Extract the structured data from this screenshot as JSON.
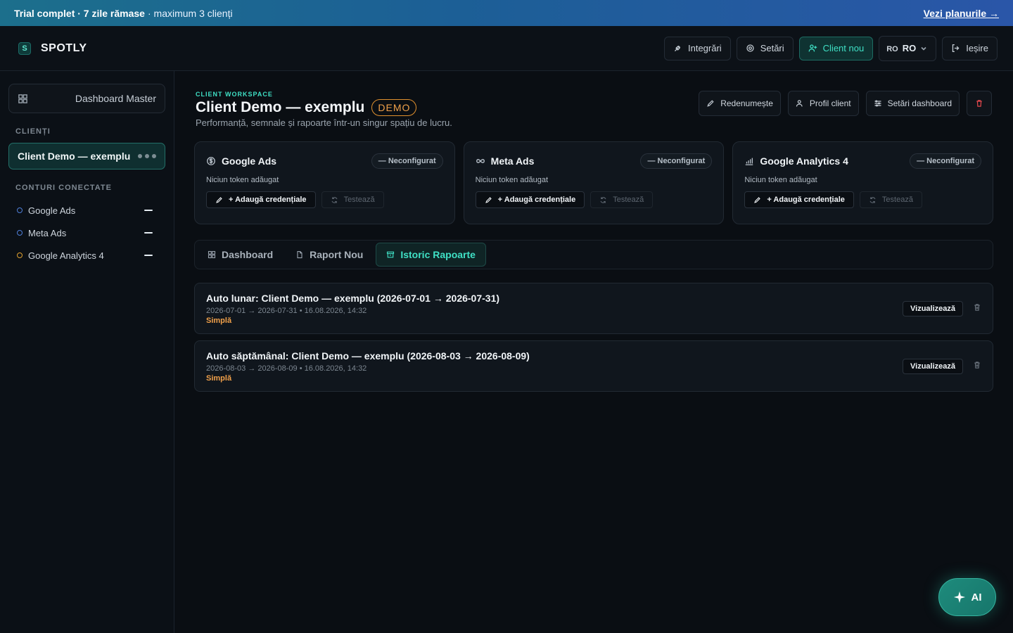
{
  "banner": {
    "strong": "Trial complet · 7 zile rămase",
    "light": "· maximum 3 clienți",
    "link": "Vezi planurile →"
  },
  "header": {
    "logo_letter": "S",
    "brand": "SPOTLY",
    "integrations": "Integrări",
    "settings": "Setări",
    "new_client": "Client nou",
    "lang_flag": "RO",
    "lang_code": "RO",
    "logout": "Ieșire"
  },
  "sidebar": {
    "master": "Dashboard Master",
    "clients_heading": "CLIENȚI",
    "client_active": "Client Demo — exemplu",
    "accounts_heading": "CONTURI CONECTATE",
    "accounts": [
      {
        "label": "Google Ads",
        "dot_color": "#4f7fd9"
      },
      {
        "label": "Meta Ads",
        "dot_color": "#4f7fd9"
      },
      {
        "label": "Google Analytics 4",
        "dot_color": "#e0a02e"
      }
    ]
  },
  "workspace": {
    "eyebrow": "CLIENT WORKSPACE",
    "title": "Client Demo — exemplu",
    "badge": "DEMO",
    "subtitle": "Performanță, semnale și rapoarte într-un singur spațiu de lucru.",
    "actions": {
      "rename": "Redenumește",
      "profile": "Profil client",
      "dashboard_settings": "Setări dashboard"
    }
  },
  "integrations": [
    {
      "name": "Google Ads",
      "icon": "dollar-circle-icon",
      "status": "— Neconfigurat",
      "token": "Niciun token adăugat",
      "add": "+ Adaugă credențiale",
      "test": "Testează"
    },
    {
      "name": "Meta Ads",
      "icon": "infinity-icon",
      "status": "— Neconfigurat",
      "token": "Niciun token adăugat",
      "add": "+ Adaugă credențiale",
      "test": "Testează"
    },
    {
      "name": "Google Analytics 4",
      "icon": "analytics-chart-icon",
      "status": "— Neconfigurat",
      "token": "Niciun token adăugat",
      "add": "+ Adaugă credențiale",
      "test": "Testează"
    }
  ],
  "tabs": [
    {
      "label": "Dashboard",
      "active": false
    },
    {
      "label": "Raport Nou",
      "active": false
    },
    {
      "label": "Istoric Rapoarte",
      "active": true
    }
  ],
  "reports": [
    {
      "title": "Auto lunar: Client Demo — exemplu (2026-07-01 → 2026-07-31)",
      "meta": "2026-07-01 → 2026-07-31 • 16.08.2026, 14:32",
      "type": "Simplă",
      "view": "Vizualizează"
    },
    {
      "title": "Auto săptămânal: Client Demo — exemplu (2026-08-03 → 2026-08-09)",
      "meta": "2026-08-03 → 2026-08-09 • 16.08.2026, 14:32",
      "type": "Simplă",
      "view": "Vizualizează"
    }
  ],
  "fab": {
    "label": "AI"
  }
}
